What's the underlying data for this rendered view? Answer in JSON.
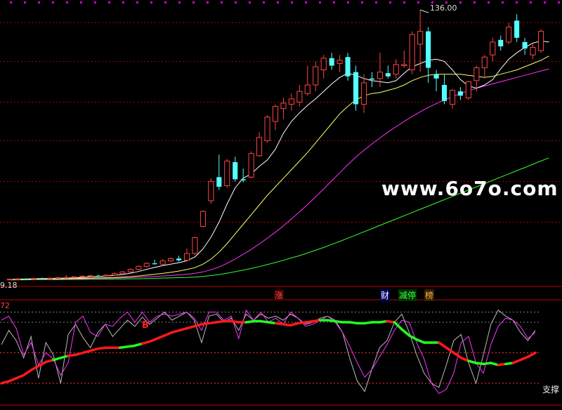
{
  "chart_data": [
    {
      "type": "candlestick",
      "title": "",
      "ylim": [
        8,
        138
      ],
      "high_label": "136.00",
      "low_label": "9.18",
      "colors": {
        "up": "#ff4444",
        "down": "#54ffff",
        "ma5": "#ffffff",
        "ma10": "#ffff66",
        "ma20": "#ff33ff",
        "ma60": "#33ff33",
        "grid": "#b00000"
      },
      "candles": [
        {
          "o": 10.2,
          "h": 10.6,
          "l": 9.9,
          "c": 10.4
        },
        {
          "o": 10.4,
          "h": 10.8,
          "l": 10.1,
          "c": 10.6
        },
        {
          "o": 10.6,
          "h": 10.9,
          "l": 10.3,
          "c": 10.5
        },
        {
          "o": 10.5,
          "h": 11.0,
          "l": 10.3,
          "c": 10.8
        },
        {
          "o": 10.8,
          "h": 11.2,
          "l": 10.6,
          "c": 10.7
        },
        {
          "o": 10.7,
          "h": 11.1,
          "l": 10.5,
          "c": 10.9
        },
        {
          "o": 10.9,
          "h": 11.4,
          "l": 10.7,
          "c": 11.1
        },
        {
          "o": 11.1,
          "h": 12.4,
          "l": 10.9,
          "c": 11.2
        },
        {
          "o": 11.2,
          "h": 11.6,
          "l": 10.8,
          "c": 11.5
        },
        {
          "o": 11.5,
          "h": 12.2,
          "l": 11.2,
          "c": 11.8
        },
        {
          "o": 11.8,
          "h": 12.4,
          "l": 11.5,
          "c": 12.0
        },
        {
          "o": 12.0,
          "h": 12.6,
          "l": 11.7,
          "c": 11.9
        },
        {
          "o": 11.9,
          "h": 12.5,
          "l": 11.6,
          "c": 12.3
        },
        {
          "o": 12.3,
          "h": 13.6,
          "l": 12.0,
          "c": 13.0
        },
        {
          "o": 13.0,
          "h": 14.2,
          "l": 12.6,
          "c": 13.8
        },
        {
          "o": 13.8,
          "h": 15.4,
          "l": 13.4,
          "c": 15.0
        },
        {
          "o": 15.0,
          "h": 16.8,
          "l": 14.6,
          "c": 16.4
        },
        {
          "o": 16.4,
          "h": 18.2,
          "l": 15.9,
          "c": 17.8
        },
        {
          "o": 17.8,
          "h": 19.5,
          "l": 17.2,
          "c": 17.4
        },
        {
          "o": 17.4,
          "h": 19.8,
          "l": 16.8,
          "c": 18.9
        },
        {
          "o": 18.9,
          "h": 20.6,
          "l": 18.4,
          "c": 20.0
        },
        {
          "o": 20.0,
          "h": 21.4,
          "l": 18.6,
          "c": 19.2
        },
        {
          "o": 19.2,
          "h": 24.8,
          "l": 19.0,
          "c": 22.4
        },
        {
          "o": 22.4,
          "h": 30.2,
          "l": 21.8,
          "c": 29.8
        },
        {
          "o": 35.0,
          "h": 42.5,
          "l": 34.6,
          "c": 42.0
        },
        {
          "o": 47.0,
          "h": 57.5,
          "l": 45.5,
          "c": 56.0
        },
        {
          "o": 58.0,
          "h": 68.5,
          "l": 52.0,
          "c": 53.5
        },
        {
          "o": 54.0,
          "h": 66.5,
          "l": 53.0,
          "c": 65.5
        },
        {
          "o": 65.0,
          "h": 67.5,
          "l": 56.0,
          "c": 57.0
        },
        {
          "o": 57.0,
          "h": 62.0,
          "l": 55.5,
          "c": 56.5
        },
        {
          "o": 58.0,
          "h": 70.0,
          "l": 57.5,
          "c": 69.0
        },
        {
          "o": 68.0,
          "h": 79.0,
          "l": 67.5,
          "c": 76.5
        },
        {
          "o": 75.0,
          "h": 87.0,
          "l": 74.0,
          "c": 86.0
        },
        {
          "o": 84.0,
          "h": 92.0,
          "l": 80.0,
          "c": 91.0
        },
        {
          "o": 90.0,
          "h": 95.0,
          "l": 85.0,
          "c": 92.5
        },
        {
          "o": 92.0,
          "h": 97.0,
          "l": 89.0,
          "c": 94.5
        },
        {
          "o": 93.0,
          "h": 101.0,
          "l": 91.0,
          "c": 98.0
        },
        {
          "o": 97.0,
          "h": 110.0,
          "l": 96.0,
          "c": 101.0
        },
        {
          "o": 101.0,
          "h": 112.0,
          "l": 98.0,
          "c": 109.5
        },
        {
          "o": 108.0,
          "h": 115.0,
          "l": 104.0,
          "c": 113.5
        },
        {
          "o": 113.5,
          "h": 116.0,
          "l": 108.0,
          "c": 110.0
        },
        {
          "o": 111.0,
          "h": 115.0,
          "l": 107.0,
          "c": 112.5
        },
        {
          "o": 114.0,
          "h": 116.0,
          "l": 103.0,
          "c": 105.0
        },
        {
          "o": 107.0,
          "h": 110.0,
          "l": 89.0,
          "c": 92.0
        },
        {
          "o": 92.0,
          "h": 106.0,
          "l": 88.0,
          "c": 102.0
        },
        {
          "o": 104.0,
          "h": 107.0,
          "l": 100.0,
          "c": 103.5
        },
        {
          "o": 104.0,
          "h": 116.0,
          "l": 100.0,
          "c": 107.0
        },
        {
          "o": 106.5,
          "h": 110.0,
          "l": 104.0,
          "c": 105.0
        },
        {
          "o": 106.0,
          "h": 113.0,
          "l": 104.0,
          "c": 110.5
        },
        {
          "o": 110.0,
          "h": 117.0,
          "l": 109.0,
          "c": 110.5
        },
        {
          "o": 108.0,
          "h": 126.0,
          "l": 106.0,
          "c": 124.5
        },
        {
          "o": 120.0,
          "h": 136.0,
          "l": 107.0,
          "c": 126.0
        },
        {
          "o": 126.0,
          "h": 128.0,
          "l": 102.0,
          "c": 109.0
        },
        {
          "o": 106.0,
          "h": 108.0,
          "l": 98.0,
          "c": 104.0
        },
        {
          "o": 101.0,
          "h": 106.0,
          "l": 92.0,
          "c": 93.5
        },
        {
          "o": 92.0,
          "h": 99.0,
          "l": 90.0,
          "c": 98.5
        },
        {
          "o": 98.0,
          "h": 100.0,
          "l": 94.0,
          "c": 96.0
        },
        {
          "o": 95.0,
          "h": 103.0,
          "l": 94.0,
          "c": 102.5
        },
        {
          "o": 103.0,
          "h": 110.0,
          "l": 98.0,
          "c": 109.0
        },
        {
          "o": 109.0,
          "h": 115.0,
          "l": 104.0,
          "c": 114.0
        },
        {
          "o": 115.0,
          "h": 123.0,
          "l": 112.0,
          "c": 121.0
        },
        {
          "o": 122.0,
          "h": 124.0,
          "l": 117.0,
          "c": 119.0
        },
        {
          "o": 121.0,
          "h": 130.0,
          "l": 120.0,
          "c": 128.0
        },
        {
          "o": 131.0,
          "h": 134.0,
          "l": 121.0,
          "c": 123.0
        },
        {
          "o": 121.0,
          "h": 123.0,
          "l": 115.0,
          "c": 118.0
        },
        {
          "o": 115.0,
          "h": 120.0,
          "l": 113.0,
          "c": 118.5
        },
        {
          "o": 117.0,
          "h": 127.0,
          "l": 116.0,
          "c": 126.0
        }
      ],
      "ma5": [
        10.3,
        10.4,
        10.5,
        10.6,
        10.7,
        10.7,
        10.8,
        10.9,
        11.0,
        11.2,
        11.5,
        11.7,
        11.9,
        12.2,
        12.6,
        13.2,
        14.0,
        15.0,
        15.9,
        16.7,
        17.4,
        18.1,
        19.0,
        20.8,
        24.5,
        30.0,
        37.0,
        45.5,
        53.0,
        57.5,
        59.5,
        63.0,
        66.0,
        71.0,
        78.5,
        84.0,
        88.0,
        91.5,
        94.5,
        98.0,
        101.5,
        104.5,
        106.5,
        105.5,
        104.0,
        103.0,
        102.5,
        102.0,
        103.0,
        106.5,
        109.5,
        111.0,
        112.5,
        113.0,
        112.0,
        108.0,
        103.5,
        100.5,
        99.5,
        101.0,
        103.5,
        108.5,
        113.0,
        116.0,
        118.5,
        120.5,
        121.5,
        121.0
      ],
      "ma10": [
        10.3,
        10.3,
        10.4,
        10.4,
        10.5,
        10.5,
        10.6,
        10.6,
        10.7,
        10.8,
        10.9,
        11.0,
        11.1,
        11.2,
        11.4,
        11.6,
        11.9,
        12.3,
        12.7,
        13.1,
        13.6,
        14.2,
        14.9,
        15.8,
        17.4,
        19.8,
        23.0,
        27.0,
        31.5,
        36.0,
        40.5,
        45.0,
        49.5,
        53.5,
        57.5,
        61.5,
        65.5,
        69.5,
        74.0,
        78.5,
        83.0,
        87.5,
        91.0,
        94.0,
        96.0,
        97.0,
        97.5,
        98.5,
        99.5,
        101.0,
        103.0,
        104.5,
        105.5,
        106.0,
        106.0,
        106.0,
        106.0,
        105.5,
        105.0,
        104.5,
        105.0,
        106.0,
        107.0,
        108.0,
        109.5,
        111.0,
        112.5,
        114.5
      ],
      "ma20": [
        10.2,
        10.3,
        10.3,
        10.4,
        10.4,
        10.4,
        10.5,
        10.5,
        10.5,
        10.6,
        10.7,
        10.7,
        10.8,
        10.9,
        11.0,
        11.1,
        11.3,
        11.5,
        11.7,
        11.9,
        12.1,
        12.4,
        12.7,
        13.1,
        13.8,
        14.8,
        16.1,
        17.8,
        19.8,
        22.0,
        24.3,
        26.8,
        29.5,
        32.3,
        35.3,
        38.5,
        41.8,
        45.2,
        48.8,
        52.5,
        56.3,
        60.0,
        63.8,
        67.3,
        70.5,
        73.5,
        76.3,
        79.0,
        81.5,
        84.0,
        86.3,
        88.5,
        90.5,
        92.3,
        94.0,
        95.5,
        97.0,
        98.3,
        99.5,
        100.5,
        101.5,
        102.5,
        103.5,
        104.5,
        105.5,
        106.5,
        107.5,
        108.5
      ],
      "ma60": [
        10.1,
        10.1,
        10.1,
        10.2,
        10.2,
        10.2,
        10.2,
        10.3,
        10.3,
        10.3,
        10.4,
        10.4,
        10.4,
        10.5,
        10.5,
        10.6,
        10.6,
        10.7,
        10.8,
        10.9,
        11.0,
        11.1,
        11.2,
        11.4,
        11.7,
        12.1,
        12.6,
        13.2,
        13.9,
        14.6,
        15.4,
        16.3,
        17.2,
        18.2,
        19.2,
        20.3,
        21.4,
        22.6,
        23.9,
        25.2,
        26.6,
        28.0,
        29.5,
        31.0,
        32.5,
        34.0,
        35.5,
        37.0,
        38.5,
        40.0,
        41.5,
        43.0,
        44.5,
        46.0,
        47.5,
        49.0,
        50.5,
        52.0,
        53.5,
        55.0,
        56.5,
        58.0,
        59.5,
        61.0,
        62.5,
        64.0,
        65.5,
        67.0
      ],
      "ma60_start": 0
    },
    {
      "type": "line",
      "title": "",
      "indicator_value": "72",
      "ylim": [
        0,
        100
      ],
      "ref_lines": [
        90,
        80,
        50,
        20
      ],
      "series": [
        {
          "color": "#bbbbbb",
          "values": [
            58,
            72,
            62,
            45,
            66,
            25,
            60,
            48,
            20,
            68,
            78,
            65,
            55,
            70,
            78,
            66,
            74,
            82,
            76,
            85,
            78,
            84,
            90,
            82,
            86,
            90,
            82,
            60,
            86,
            88,
            80,
            84,
            72,
            88,
            82,
            88,
            84,
            86,
            82,
            88,
            84,
            78,
            80,
            84,
            86,
            82,
            70,
            44,
            22,
            12,
            35,
            55,
            62,
            80,
            88,
            70,
            48,
            30,
            20,
            16,
            38,
            62,
            68,
            40,
            20,
            48,
            78,
            92,
            86,
            82,
            70,
            62,
            72
          ]
        },
        {
          "color": "#ff33ff",
          "values": [
            82,
            86,
            74,
            48,
            60,
            38,
            50,
            44,
            28,
            40,
            80,
            86,
            70,
            66,
            78,
            76,
            84,
            90,
            80,
            90,
            80,
            86,
            88,
            86,
            88,
            90,
            84,
            72,
            90,
            90,
            82,
            86,
            64,
            92,
            82,
            90,
            80,
            84,
            78,
            90,
            84,
            76,
            78,
            82,
            86,
            80,
            70,
            56,
            40,
            26,
            34,
            46,
            58,
            72,
            82,
            80,
            60,
            44,
            20,
            10,
            14,
            30,
            60,
            66,
            40,
            30,
            58,
            76,
            84,
            82,
            76,
            64,
            70
          ]
        }
      ],
      "thick_line": {
        "values": [
          20,
          22,
          25,
          28,
          33,
          37,
          41,
          43,
          45,
          47,
          48,
          50,
          52,
          54,
          55,
          55,
          55,
          56,
          57,
          59,
          61,
          64,
          67,
          70,
          72,
          74,
          76,
          78,
          79,
          80,
          81,
          81,
          80,
          80,
          81,
          81,
          80,
          79,
          78,
          77,
          79,
          80,
          81,
          82,
          82,
          81,
          80,
          80,
          79,
          79,
          80,
          80,
          81,
          80,
          73,
          67,
          63,
          60,
          60,
          60,
          55,
          50,
          45,
          42,
          40,
          39,
          40,
          38,
          39,
          40,
          43,
          46,
          50
        ],
        "color_segments": [
          "r",
          "r",
          "r",
          "r",
          "r",
          "r",
          "r",
          "g",
          "g",
          "r",
          "r",
          "r",
          "r",
          "r",
          "r",
          "r",
          "g",
          "g",
          "g",
          "r",
          "r",
          "r",
          "r",
          "r",
          "r",
          "r",
          "r",
          "r",
          "r",
          "r",
          "r",
          "r",
          "r",
          "g",
          "g",
          "g",
          "g",
          "r",
          "r",
          "r",
          "r",
          "r",
          "r",
          "g",
          "g",
          "g",
          "g",
          "g",
          "g",
          "g",
          "g",
          "g",
          "r",
          "g",
          "g",
          "g",
          "g",
          "g",
          "g",
          "r",
          "r",
          "r",
          "r",
          "g",
          "g",
          "g",
          "g",
          "r",
          "g",
          "r",
          "r",
          "r",
          "r"
        ]
      },
      "annotations": {
        "b_marker": "B",
        "support_label": "支撑"
      }
    }
  ],
  "main_badges": [
    {
      "text": "涨",
      "color": "#ff5050",
      "bg": "#3a0000"
    },
    {
      "text": "财",
      "color": "#ffffff",
      "bg": "#000060"
    },
    {
      "text": "减停",
      "color": "#40ff40",
      "bg": "#003000"
    },
    {
      "text": "榜",
      "color": "#ffb347",
      "bg": "#302000"
    }
  ],
  "watermark": "www.6o7o.com"
}
